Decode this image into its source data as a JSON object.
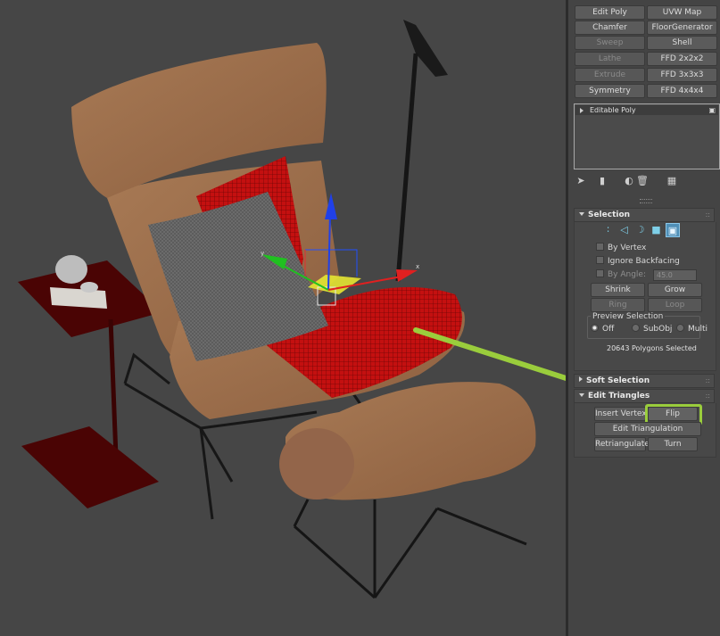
{
  "modifier_buttons": [
    {
      "label": "Edit Poly",
      "disabled": false
    },
    {
      "label": "UVW Map",
      "disabled": false
    },
    {
      "label": "Chamfer",
      "disabled": false
    },
    {
      "label": "FloorGenerator",
      "disabled": false
    },
    {
      "label": "Sweep",
      "disabled": true
    },
    {
      "label": "Shell",
      "disabled": false
    },
    {
      "label": "Lathe",
      "disabled": true
    },
    {
      "label": "FFD 2x2x2",
      "disabled": false
    },
    {
      "label": "Extrude",
      "disabled": true
    },
    {
      "label": "FFD 3x3x3",
      "disabled": false
    },
    {
      "label": "Symmetry",
      "disabled": false
    },
    {
      "label": "FFD 4x4x4",
      "disabled": false
    }
  ],
  "modifier_stack": {
    "items": [
      "Editable Poly"
    ]
  },
  "stack_tools": [
    "pin-stack-icon",
    "show-end-result-icon",
    "make-unique-icon",
    "remove-modifier-icon",
    "configure-modifier-sets-icon"
  ],
  "selection": {
    "title": "Selection",
    "by_vertex": "By Vertex",
    "ignore_backfacing": "Ignore Backfacing",
    "by_angle": "By Angle:",
    "angle_value": "45.0",
    "shrink": "Shrink",
    "grow": "Grow",
    "ring": "Ring",
    "loop": "Loop",
    "preview_title": "Preview Selection",
    "preview_options": [
      "Off",
      "SubObj",
      "Multi"
    ],
    "preview_selected": "Off",
    "status": "20643 Polygons Selected"
  },
  "soft_selection": {
    "title": "Soft Selection"
  },
  "edit_triangles": {
    "title": "Edit Triangles",
    "insert_vertex": "Insert Vertex",
    "flip": "Flip",
    "edit_triangulation": "Edit Triangulation",
    "retriangulate": "Retriangulate",
    "turn": "Turn"
  },
  "gizmo": {
    "x_label": "x",
    "y_label": "y"
  },
  "colors": {
    "viewport_bg": "#464646",
    "panel_bg": "#444444",
    "callout_green": "#9acd3c",
    "selection_red": "#c81414",
    "gizmo_x": "#e02020",
    "gizmo_y": "#20c020",
    "gizmo_z": "#2040e8"
  }
}
